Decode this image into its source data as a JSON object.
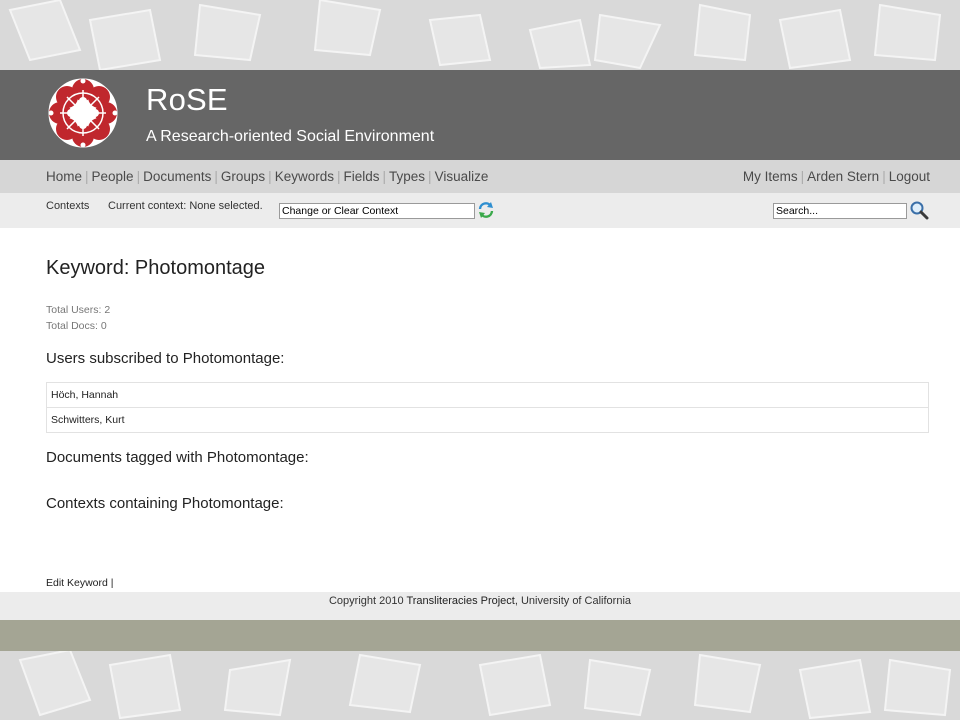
{
  "site": {
    "title": "RoSE",
    "subtitle": "A Research-oriented Social Environment"
  },
  "nav": {
    "left": [
      "Home",
      "People",
      "Documents",
      "Groups",
      "Keywords",
      "Fields",
      "Types",
      "Visualize"
    ],
    "right": [
      "My Items",
      "Arden Stern",
      "Logout"
    ]
  },
  "context": {
    "label": "Contexts",
    "current": "Current context: None selected.",
    "select_value": "Change or Clear Context",
    "search_value": "Search..."
  },
  "keyword": {
    "title": "Keyword: Photomontage",
    "total_users": "Total Users: 2",
    "total_docs": "Total Docs: 0",
    "users_heading": "Users subscribed to Photomontage:",
    "users": [
      "Höch, Hannah",
      "Schwitters, Kurt"
    ],
    "docs_heading": "Documents tagged with Photomontage:",
    "contexts_heading": "Contexts containing Photomontage:",
    "edit_label": "Edit Keyword",
    "edit_sep": "|"
  },
  "footer": {
    "prefix": "Copyright 2010 ",
    "org": "Transliteracies Project",
    "suffix": ", University of California"
  },
  "colors": {
    "header_bg": "#666666",
    "nav_bg": "#d6d6d6",
    "olive_band": "#a4a594",
    "logo_red": "#c0272d"
  },
  "icons": {
    "logo": "rose-logo-icon",
    "refresh": "refresh-icon",
    "search": "search-icon"
  }
}
